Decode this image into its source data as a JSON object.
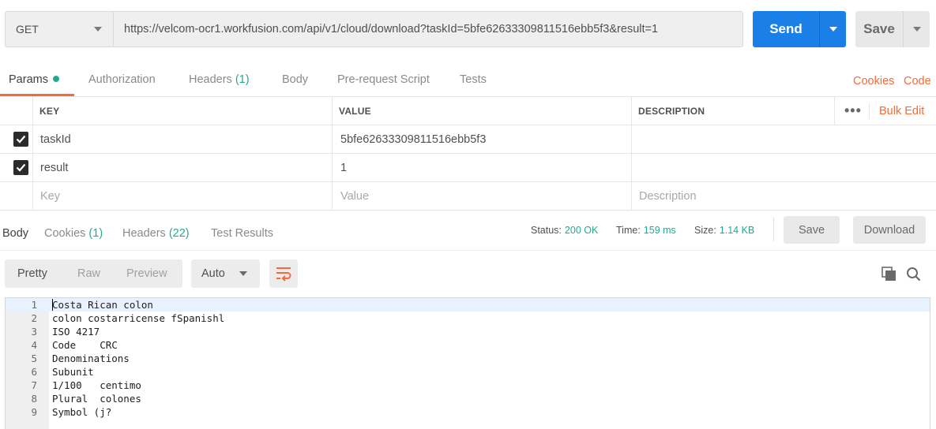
{
  "request": {
    "method": "GET",
    "url": "https://velcom-ocr1.workfusion.com/api/v1/cloud/download?taskId=5bfe62633309811516ebb5f3&result=1",
    "send_label": "Send",
    "save_label": "Save"
  },
  "request_tabs": [
    {
      "label": "Params",
      "active": true
    },
    {
      "label": "Authorization"
    },
    {
      "label": "Headers",
      "count": "(1)"
    },
    {
      "label": "Body"
    },
    {
      "label": "Pre-request Script"
    },
    {
      "label": "Tests"
    }
  ],
  "request_links": {
    "cookies": "Cookies",
    "code": "Code"
  },
  "params_table": {
    "headers": {
      "key": "KEY",
      "value": "VALUE",
      "description": "DESCRIPTION"
    },
    "bulk_edit": "Bulk Edit",
    "more": "•••",
    "rows": [
      {
        "checked": true,
        "key": "taskId",
        "value": "5bfe62633309811516ebb5f3",
        "description": ""
      },
      {
        "checked": true,
        "key": "result",
        "value": "1",
        "description": ""
      }
    ],
    "placeholders": {
      "key": "Key",
      "value": "Value",
      "description": "Description"
    }
  },
  "response_tabs": [
    {
      "label": "Body",
      "active": true
    },
    {
      "label": "Cookies",
      "count": "(1)"
    },
    {
      "label": "Headers",
      "count": "(22)"
    },
    {
      "label": "Test Results"
    }
  ],
  "response_meta": {
    "status_label": "Status:",
    "status_value": "200 OK",
    "time_label": "Time:",
    "time_value": "159 ms",
    "size_label": "Size:",
    "size_value": "1.14 KB",
    "save_label": "Save",
    "download_label": "Download"
  },
  "view_modes": [
    "Pretty",
    "Raw",
    "Preview"
  ],
  "format": "Auto",
  "icons": {
    "wrap": "wrap-lines-icon",
    "copy": "copy-icon",
    "search": "search-icon"
  },
  "colors": {
    "accent": "#f26b3a",
    "send": "#1a7fe6",
    "success": "#26a98b"
  },
  "code_lines": [
    "Costa Rican colon",
    "colon costarricense fSpanishl",
    "ISO 4217",
    "Code    CRC",
    "Denominations",
    "Subunit",
    "1/100   centimo",
    "Plural  colones",
    "Symbol (j?"
  ]
}
